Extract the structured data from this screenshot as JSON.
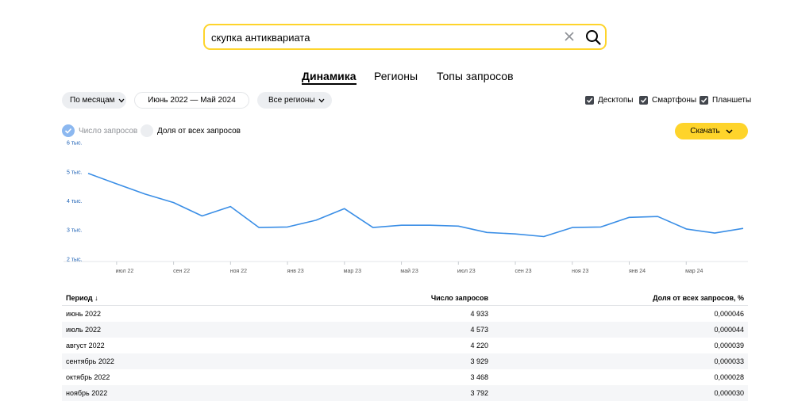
{
  "search": {
    "query": "скупка антиквариата"
  },
  "tabs": [
    {
      "label": "Динамика"
    },
    {
      "label": "Регионы"
    },
    {
      "label": "Топы запросов"
    }
  ],
  "filters": {
    "grouping": "По месяцам",
    "date_range": "Июнь 2022 — Май 2024",
    "region": "Все регионы"
  },
  "devices": [
    {
      "label": "Десктопы",
      "checked": true
    },
    {
      "label": "Смартфоны",
      "checked": true
    },
    {
      "label": "Планшеты",
      "checked": true
    }
  ],
  "metrics": {
    "count_label": "Число запросов",
    "share_label": "Доля от всех запросов",
    "selected": "count"
  },
  "download_label": "Скачать",
  "colors": {
    "accent": "#fed42b",
    "line": "#3a8ee6",
    "axis_text": "#1a5fb4"
  },
  "chart_data": {
    "type": "line",
    "y_ticks": [
      {
        "value": 2000,
        "label": "2 тыс."
      },
      {
        "value": 3000,
        "label": "3 тыс."
      },
      {
        "value": 4000,
        "label": "4 тыс."
      },
      {
        "value": 5000,
        "label": "5 тыс."
      },
      {
        "value": 6000,
        "label": "6 тыс."
      }
    ],
    "ylim": [
      1900,
      6100
    ],
    "x_ticks": [
      {
        "index": 1,
        "label": "июл 22"
      },
      {
        "index": 3,
        "label": "сен 22"
      },
      {
        "index": 5,
        "label": "ноя 22"
      },
      {
        "index": 7,
        "label": "янв 23"
      },
      {
        "index": 9,
        "label": "мар 23"
      },
      {
        "index": 11,
        "label": "май 23"
      },
      {
        "index": 13,
        "label": "июл 23"
      },
      {
        "index": 15,
        "label": "сен 23"
      },
      {
        "index": 17,
        "label": "ноя 23"
      },
      {
        "index": 19,
        "label": "янв 24"
      },
      {
        "index": 21,
        "label": "мар 24"
      }
    ],
    "series": [
      {
        "values": [
          4933,
          4573,
          4220,
          3929,
          3468,
          3792,
          3070,
          3090,
          3320,
          3720,
          3070,
          3150,
          3150,
          3120,
          2900,
          2850,
          2760,
          3070,
          3090,
          3420,
          3450,
          3020,
          2880,
          3040
        ]
      }
    ]
  },
  "table": {
    "headers": [
      "Период",
      "Число запросов",
      "Доля от всех запросов, %"
    ],
    "rows": [
      [
        "июнь 2022",
        "4 933",
        "0,000046"
      ],
      [
        "июль 2022",
        "4 573",
        "0,000044"
      ],
      [
        "август 2022",
        "4 220",
        "0,000039"
      ],
      [
        "сентябрь 2022",
        "3 929",
        "0,000033"
      ],
      [
        "октябрь 2022",
        "3 468",
        "0,000028"
      ],
      [
        "ноябрь 2022",
        "3 792",
        "0,000030"
      ]
    ]
  }
}
